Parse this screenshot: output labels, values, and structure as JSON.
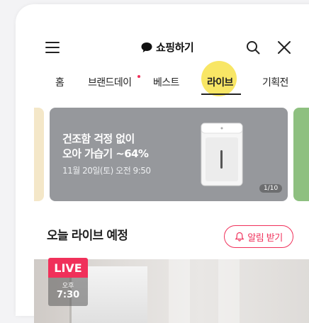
{
  "header": {
    "logo_text": "쇼핑하기"
  },
  "tabs": [
    {
      "label": "홈"
    },
    {
      "label": "브랜드데이"
    },
    {
      "label": "베스트"
    },
    {
      "label": "라이브"
    },
    {
      "label": "기획전"
    }
  ],
  "banner": {
    "title_line1": "건조함 걱정 없이",
    "title_line2": "오아 가습기 ~64%",
    "date": "11월 20일(토) 오전 9:50",
    "counter": "1/10"
  },
  "section": {
    "title": "오늘 라이브 예정",
    "alarm_label": "알림 받기"
  },
  "live_card": {
    "badge": "LIVE",
    "ampm": "오후",
    "time": "7:30"
  },
  "colors": {
    "accent": "#f0305a",
    "highlight": "#f7e24a",
    "banner_bg": "#96989c"
  }
}
